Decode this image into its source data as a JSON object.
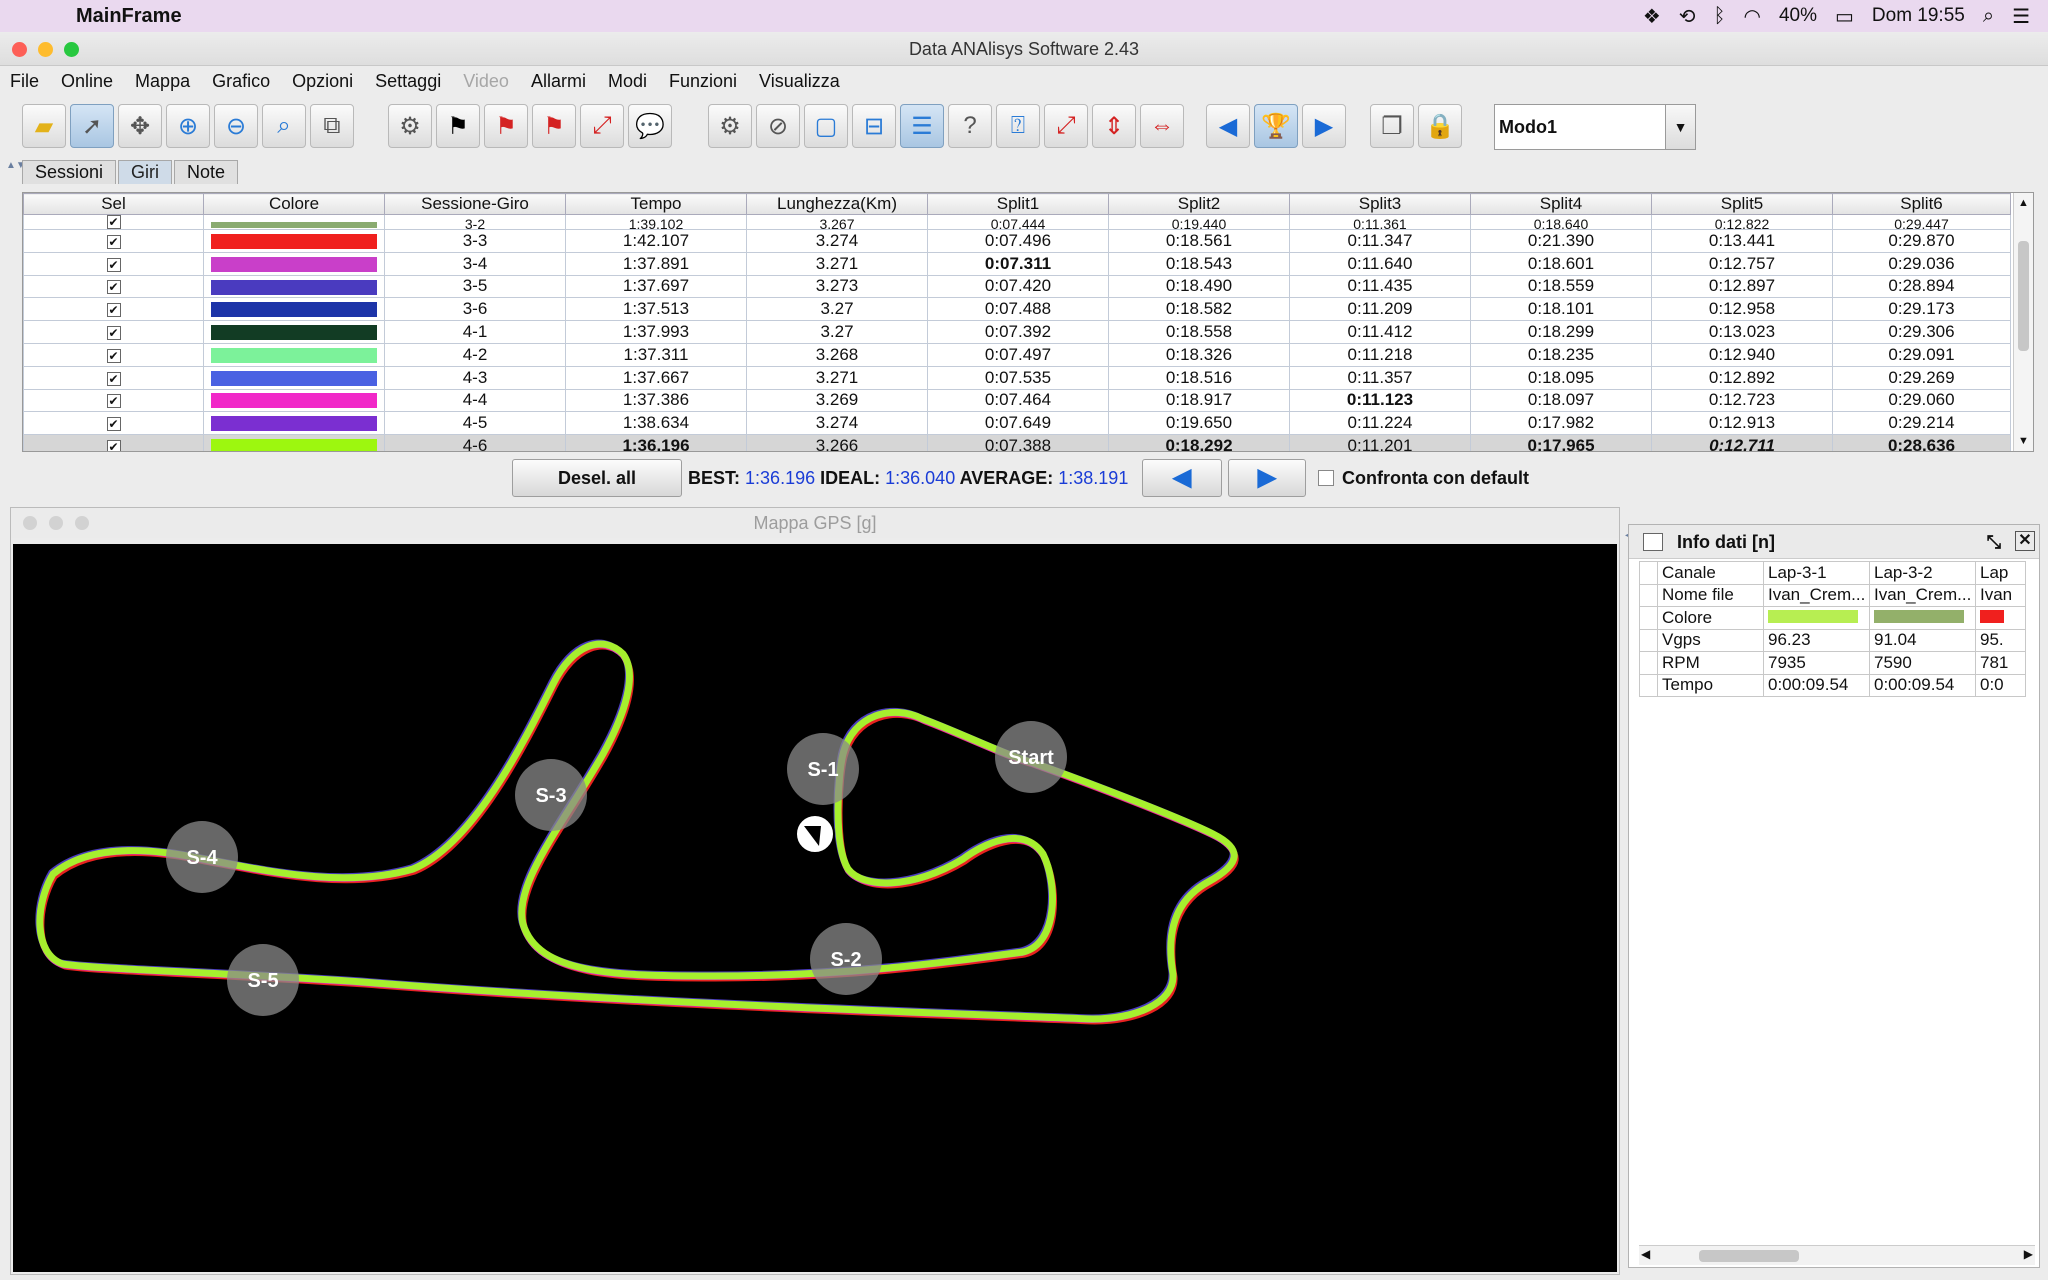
{
  "menubar": {
    "app": "MainFrame",
    "battery": "40%",
    "clock": "Dom 19:55"
  },
  "window": {
    "title": "Data ANAlisys Software 2.43"
  },
  "menu": [
    "File",
    "Online",
    "Mappa",
    "Grafico",
    "Opzioni",
    "Settaggi",
    "Video",
    "Allarmi",
    "Modi",
    "Funzioni",
    "Visualizza"
  ],
  "toolbar": {
    "mode_value": "Modo1"
  },
  "tabs": [
    "Sessioni",
    "Giri",
    "Note"
  ],
  "laps": {
    "columns": [
      "Sel",
      "Colore",
      "Sessione-Giro",
      "Tempo",
      "Lunghezza(Km)",
      "Split1",
      "Split2",
      "Split3",
      "Split4",
      "Split5",
      "Split6"
    ],
    "partial_row": [
      "3-2",
      "1:39.102",
      "3.267",
      "0:07.444",
      "0:19.440",
      "0:11.361",
      "0:18.640",
      "0:12.822",
      "0:29.447"
    ],
    "rows": [
      {
        "color": "#f0201e",
        "vals": [
          "3-3",
          "1:42.107",
          "3.274",
          "0:07.496",
          "0:18.561",
          "0:11.347",
          "0:21.390",
          "0:13.441",
          "0:29.870"
        ]
      },
      {
        "color": "#c93fc9",
        "vals": [
          "3-4",
          "1:37.891",
          "3.271",
          "0:07.311",
          "0:18.543",
          "0:11.640",
          "0:18.601",
          "0:12.757",
          "0:29.036"
        ]
      },
      {
        "color": "#4a3bbf",
        "vals": [
          "3-5",
          "1:37.697",
          "3.273",
          "0:07.420",
          "0:18.490",
          "0:11.435",
          "0:18.559",
          "0:12.897",
          "0:28.894"
        ]
      },
      {
        "color": "#1d34a8",
        "vals": [
          "3-6",
          "1:37.513",
          "3.27",
          "0:07.488",
          "0:18.582",
          "0:11.209",
          "0:18.101",
          "0:12.958",
          "0:29.173"
        ]
      },
      {
        "color": "#123c24",
        "vals": [
          "4-1",
          "1:37.993",
          "3.27",
          "0:07.392",
          "0:18.558",
          "0:11.412",
          "0:18.299",
          "0:13.023",
          "0:29.306"
        ]
      },
      {
        "color": "#7cf29a",
        "vals": [
          "4-2",
          "1:37.311",
          "3.268",
          "0:07.497",
          "0:18.326",
          "0:11.218",
          "0:18.235",
          "0:12.940",
          "0:29.091"
        ]
      },
      {
        "color": "#4a61e2",
        "vals": [
          "4-3",
          "1:37.667",
          "3.271",
          "0:07.535",
          "0:18.516",
          "0:11.357",
          "0:18.095",
          "0:12.892",
          "0:29.269"
        ]
      },
      {
        "color": "#f128c8",
        "vals": [
          "4-4",
          "1:37.386",
          "3.269",
          "0:07.464",
          "0:18.917",
          "0:11.123",
          "0:18.097",
          "0:12.723",
          "0:29.060"
        ]
      },
      {
        "color": "#7b2fd1",
        "vals": [
          "4-5",
          "1:38.634",
          "3.274",
          "0:07.649",
          "0:19.650",
          "0:11.224",
          "0:17.982",
          "0:12.913",
          "0:29.214"
        ]
      },
      {
        "color": "#9df70f",
        "vals": [
          "4-6",
          "1:36.196",
          "3.266",
          "0:07.388",
          "0:18.292",
          "0:11.201",
          "0:17.965",
          "0:12.711",
          "0:28.636"
        ]
      }
    ]
  },
  "summary": {
    "desel": "Desel. all",
    "best_label": "BEST:",
    "best": "1:36.196",
    "ideal_label": "IDEAL:",
    "ideal": "1:36.040",
    "avg_label": "AVERAGE:",
    "avg": "1:38.191",
    "compare": "Confronta con default"
  },
  "gps": {
    "title": "Mappa GPS [g]",
    "markers": [
      "Start",
      "S-1",
      "S-2",
      "S-3",
      "S-4",
      "S-5"
    ]
  },
  "info": {
    "title": "Info dati [n]",
    "rows": [
      [
        "Canale",
        "Lap-3-1",
        "Lap-3-2",
        "Lap"
      ],
      [
        "Nome file",
        "Ivan_Crem...",
        "Ivan_Crem...",
        "Ivan"
      ],
      [
        "Colore",
        "",
        "",
        ""
      ],
      [
        "Vgps",
        "96.23",
        "91.04",
        "95."
      ],
      [
        "RPM",
        "7935",
        "7590",
        "781"
      ],
      [
        "Tempo",
        "0:00:09.54",
        "0:00:09.54",
        "0:0"
      ]
    ],
    "colors": [
      "#b7ee52",
      "#93b06a",
      "#f0201e"
    ]
  }
}
